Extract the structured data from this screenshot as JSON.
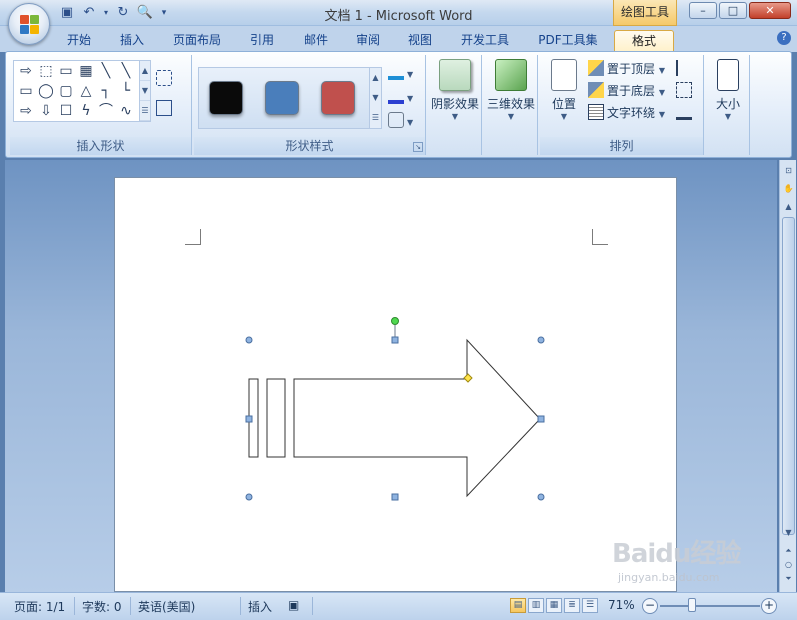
{
  "window": {
    "title": "文档 1 - Microsoft Word",
    "contextual_tab_group": "绘图工具",
    "controls": {
      "minimize": "–",
      "maximize": "□",
      "close": "✕"
    }
  },
  "quick_access": {
    "save_icon": "save-icon",
    "undo_icon": "undo-icon",
    "redo_icon": "redo-icon",
    "print_preview_icon": "print-preview-icon"
  },
  "tabs": [
    {
      "label": "开始"
    },
    {
      "label": "插入"
    },
    {
      "label": "页面布局"
    },
    {
      "label": "引用"
    },
    {
      "label": "邮件"
    },
    {
      "label": "审阅"
    },
    {
      "label": "视图"
    },
    {
      "label": "开发工具"
    },
    {
      "label": "PDF工具集"
    },
    {
      "label": "格式",
      "active": true
    }
  ],
  "ribbon": {
    "insert_shapes": {
      "label": "插入形状",
      "shapes": [
        "⇨",
        "⬚",
        "▭",
        "▦",
        "╲",
        "╲",
        "▭",
        "◯",
        "▢",
        "△",
        "┐",
        "└",
        "⇨",
        "⇩",
        "☐",
        "ϟ",
        "⌒",
        "∿"
      ]
    },
    "shape_styles": {
      "label": "形状样式",
      "swatches": [
        "#0a0a0a",
        "#4a7ebb",
        "#c0504d"
      ]
    },
    "shadow_effects": {
      "label": "阴影效果"
    },
    "three_d_effects": {
      "label": "三维效果"
    },
    "arrange": {
      "label": "排列",
      "position": "位置",
      "bring_to_front": "置于顶层",
      "send_to_back": "置于底层",
      "text_wrap": "文字环绕"
    },
    "size": {
      "label": "大小"
    }
  },
  "document": {
    "shape": "striped-right-arrow",
    "selected": true
  },
  "status": {
    "page": "页面: 1/1",
    "words": "字数: 0",
    "language": "英语(美国)",
    "mode": "插入",
    "zoom": "71%"
  },
  "watermark": {
    "brand": "Baidu经验",
    "url": "jingyan.baidu.com"
  }
}
